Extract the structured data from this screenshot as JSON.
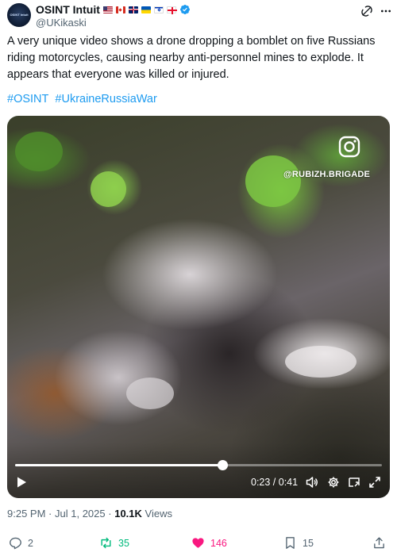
{
  "author": {
    "name": "OSINT Intuit",
    "handle": "@UKikaski",
    "avatar_text": "OSINT Intuit",
    "flags": [
      "us-flag",
      "canada-flag",
      "uk-flag",
      "ukraine-flag",
      "israel-flag",
      "georgia-flag"
    ]
  },
  "tweet": {
    "text": "A very unique video shows a drone dropping a bomblet on five Russians riding motorcycles, causing nearby anti-personnel mines to explode. It appears that everyone was killed or injured.",
    "hashtags": [
      "#OSINT",
      "#UkraineRussiaWar"
    ]
  },
  "video": {
    "watermark": "@RUBIZH.BRIGADE",
    "current_time": "0:23",
    "duration": "0:41",
    "time_display": "0:23 / 0:41",
    "progress": 0.565
  },
  "meta": {
    "time": "9:25 PM",
    "separator": "·",
    "date": "Jul 1, 2025",
    "views_count": "10.1K",
    "views_label": "Views"
  },
  "actions": {
    "replies": "2",
    "reposts": "35",
    "likes": "146",
    "bookmarks": "15"
  },
  "colors": {
    "accent": "#1d9bf0",
    "repost_active": "#00ba7c",
    "like_active": "#f91880",
    "muted": "#536471"
  }
}
